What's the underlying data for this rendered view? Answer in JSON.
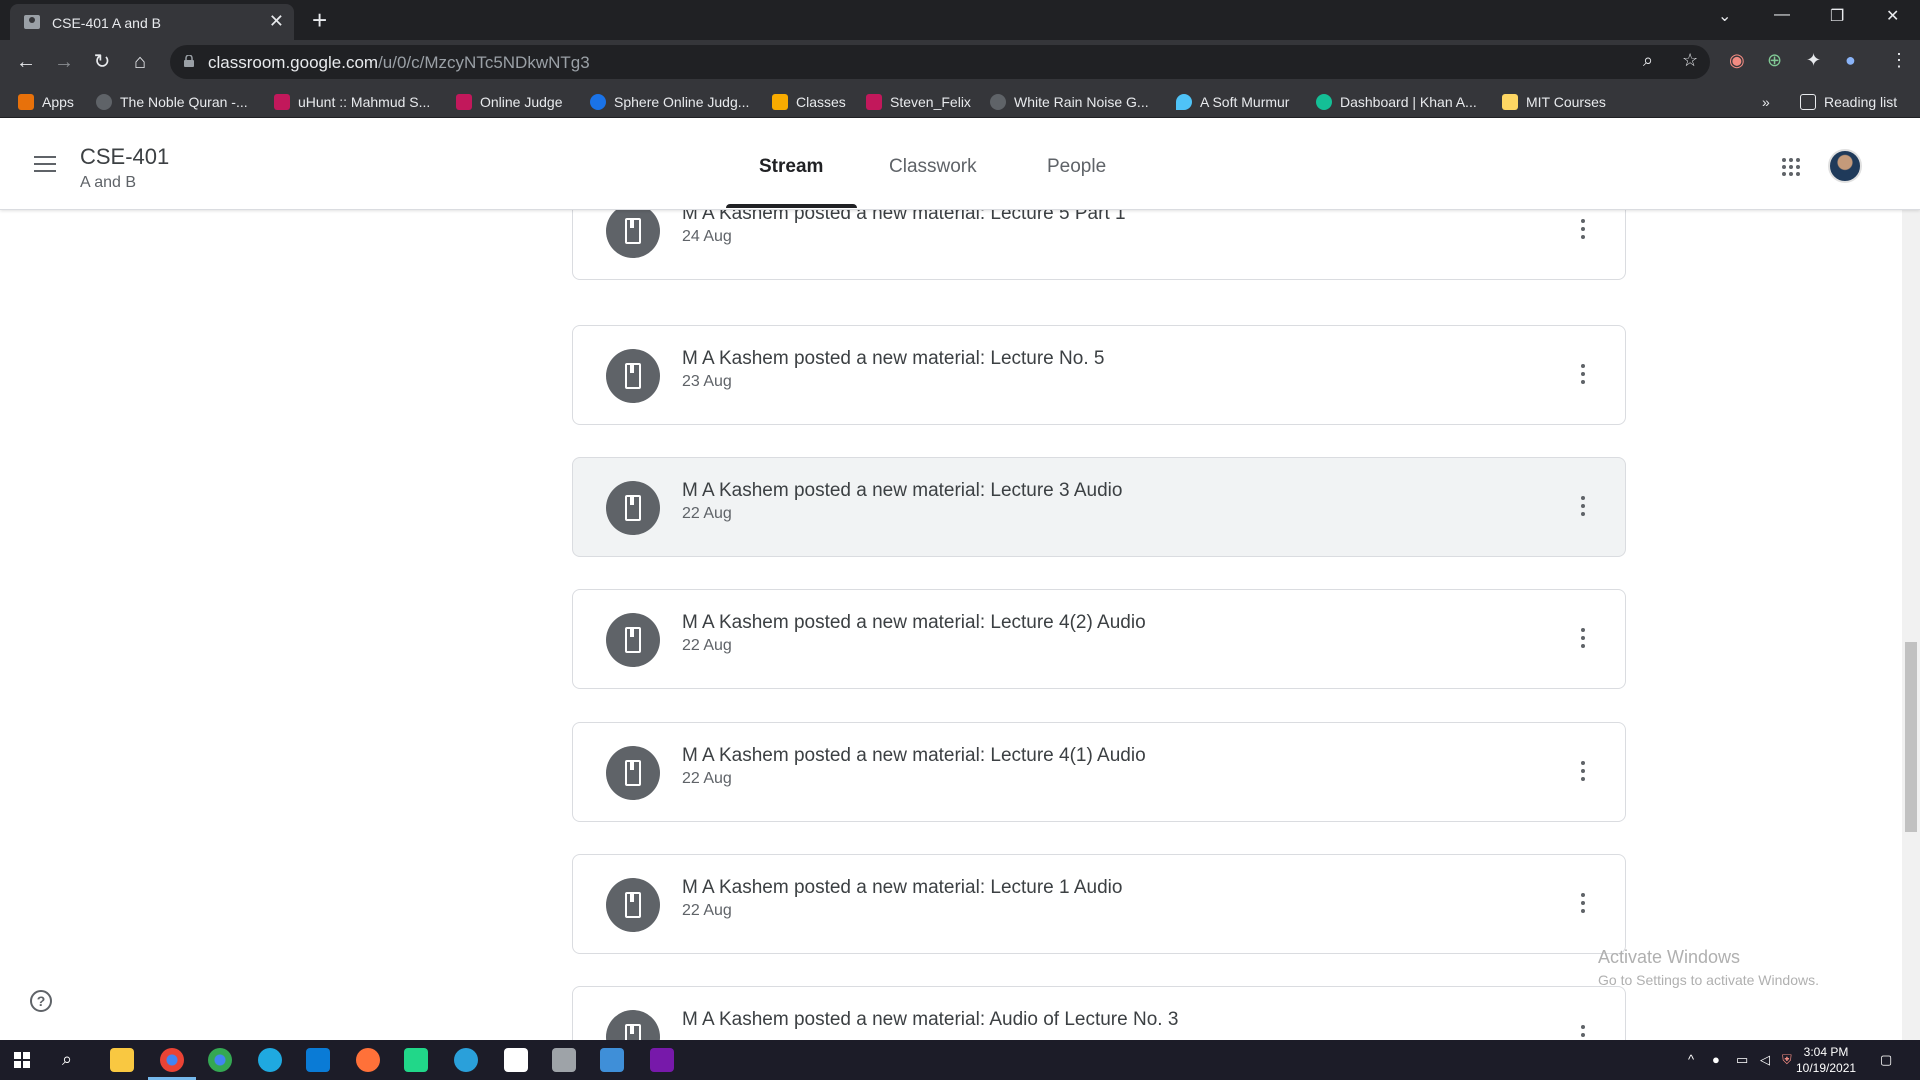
{
  "browser": {
    "tab_title": "CSE-401 A and B",
    "url_host": "classroom.google.com",
    "url_path": "/u/0/c/MzcyNTc5NDkwNTg3",
    "bookmarks": [
      {
        "label": "Apps",
        "color": "#e8710a"
      },
      {
        "label": "The Noble Quran -...",
        "color": "#5f6368"
      },
      {
        "label": "uHunt :: Mahmud S...",
        "color": "#c2185b"
      },
      {
        "label": "Online Judge",
        "color": "#c2185b"
      },
      {
        "label": "Sphere Online Judg...",
        "color": "#1a73e8"
      },
      {
        "label": "Classes",
        "color": "#f9ab00"
      },
      {
        "label": "Steven_Felix",
        "color": "#c2185b"
      },
      {
        "label": "White Rain Noise G...",
        "color": "#5f6368"
      },
      {
        "label": "A Soft Murmur",
        "color": "#4fc3f7"
      },
      {
        "label": "Dashboard | Khan A...",
        "color": "#14bf96"
      },
      {
        "label": "MIT Courses",
        "color": "#fdd663"
      }
    ],
    "bookmarks_overflow": "»",
    "reading_list": "Reading list"
  },
  "header": {
    "course_title": "CSE-401",
    "course_section": "A and B",
    "tabs": [
      {
        "label": "Stream",
        "active": true
      },
      {
        "label": "Classwork",
        "active": false
      },
      {
        "label": "People",
        "active": false
      }
    ]
  },
  "stream": [
    {
      "title": "M A Kashem posted a new material: Lecture 5 Part 1",
      "date": "24 Aug",
      "hover": false
    },
    {
      "title": "M A Kashem posted a new material: Lecture No. 5",
      "date": "23 Aug",
      "hover": false
    },
    {
      "title": "M A Kashem posted a new material: Lecture 3 Audio",
      "date": "22 Aug",
      "hover": true
    },
    {
      "title": "M A Kashem posted a new material: Lecture 4(2) Audio",
      "date": "22 Aug",
      "hover": false
    },
    {
      "title": "M A Kashem posted a new material: Lecture 4(1) Audio",
      "date": "22 Aug",
      "hover": false
    },
    {
      "title": "M A Kashem posted a new material: Lecture 1 Audio",
      "date": "22 Aug",
      "hover": false
    },
    {
      "title": "M A Kashem posted a new material: Audio of Lecture No. 3",
      "date": "",
      "hover": false
    }
  ],
  "help_label": "?",
  "watermark": {
    "line1": "Activate Windows",
    "line2": "Go to Settings to activate Windows."
  },
  "taskbar": {
    "time": "3:04 PM",
    "date": "10/19/2021"
  }
}
